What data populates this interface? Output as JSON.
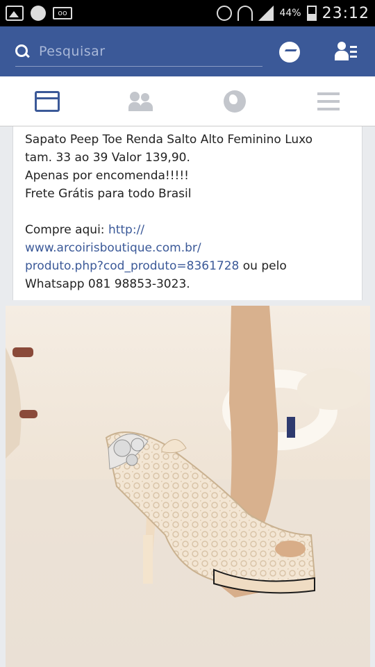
{
  "status_bar": {
    "battery": "44%",
    "time": "23:12"
  },
  "top_bar": {
    "search_placeholder": "Pesquisar"
  },
  "post": {
    "lines": [
      "Sapato Peep Toe Renda Salto Alto Feminino Luxo",
      "tam. 33 ao 39 Valor 139,90.",
      "Apenas por encomenda!!!!!",
      "Frete Grátis para todo Brasil"
    ],
    "buy_prefix": "Compre aqui: ",
    "link_line1": "http://",
    "link_line2": "www.arcoirisboutique.com.br/",
    "link_line3": "produto.php?cod_produto=8361728",
    "after_link": " ou pelo",
    "whatsapp": "Whatsapp 081 98853-3023."
  },
  "colors": {
    "facebook_blue": "#3b5998",
    "link": "#3b5998"
  }
}
